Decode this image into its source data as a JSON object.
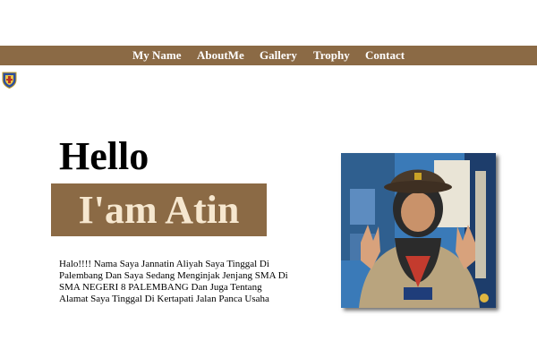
{
  "nav": {
    "items": [
      {
        "label": "My Name"
      },
      {
        "label": "AboutMe"
      },
      {
        "label": "Gallery"
      },
      {
        "label": "Trophy"
      },
      {
        "label": "Contact"
      }
    ]
  },
  "hero": {
    "greeting": "Hello",
    "name": "I'am Atin",
    "intro": "Halo!!!! Nama Saya Jannatin Aliyah Saya Tinggal Di Palembang Dan Saya Sedang Menginjak Jenjang SMA Di SMA NEGERI 8 PALEMBANG Dan Juga Tentang Alamat Saya Tinggal Di Kertapati Jalan Panca Usaha"
  },
  "colors": {
    "accent_brown": "#8b6a45",
    "name_text": "#f6e7cf",
    "nav_text": "#ffffff"
  },
  "icons": {
    "logo": "school-crest-icon"
  }
}
